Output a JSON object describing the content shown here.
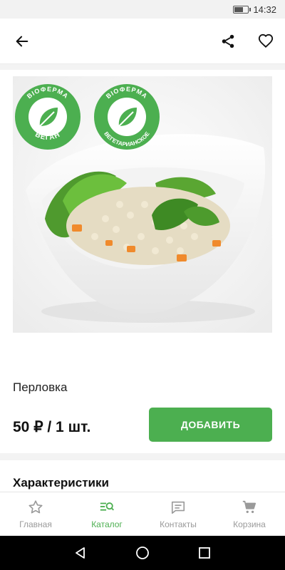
{
  "status_bar": {
    "time": "14:32"
  },
  "app_bar": {
    "back_icon": "arrow-left-icon",
    "share_icon": "share-icon",
    "favorite_icon": "heart-icon"
  },
  "product": {
    "badges": [
      {
        "top_text": "BIOФЕРМА",
        "bottom_text": "ВЕГАН"
      },
      {
        "top_text": "BIOФЕРМА",
        "bottom_text": "ВЕГЕТАРИАНСКОЕ"
      }
    ],
    "name": "Перловка",
    "price": "50 ₽ / 1 шт.",
    "add_label": "ДОБАВИТЬ"
  },
  "characteristics": {
    "title": "Характеристики"
  },
  "bottom_nav": {
    "items": [
      {
        "label": "Главная",
        "icon": "star-icon",
        "active": false
      },
      {
        "label": "Каталог",
        "icon": "catalog-search-icon",
        "active": true
      },
      {
        "label": "Контакты",
        "icon": "message-icon",
        "active": false
      },
      {
        "label": "Корзина",
        "icon": "cart-icon",
        "active": false
      }
    ]
  },
  "colors": {
    "accent": "#4caf50",
    "inactive": "#9a9a9a"
  }
}
